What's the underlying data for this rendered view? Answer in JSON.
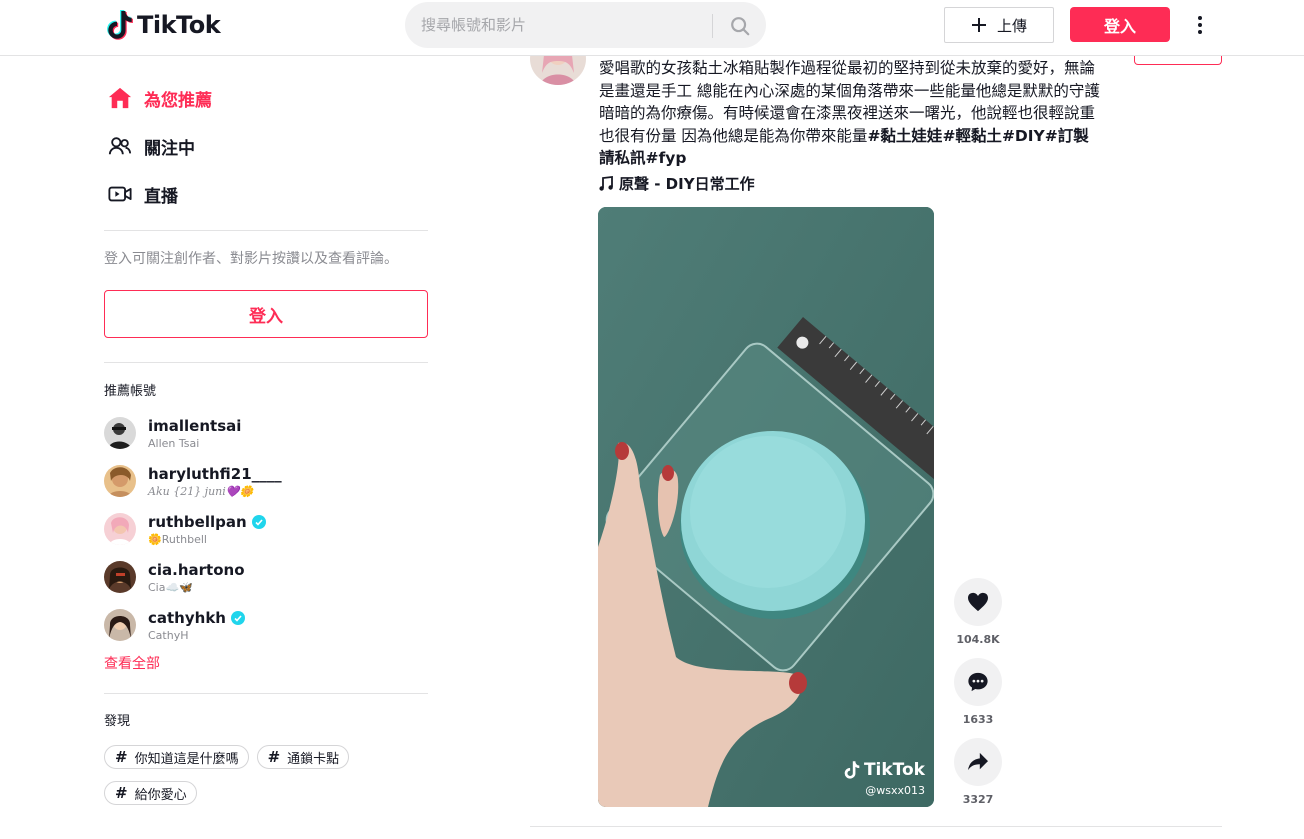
{
  "header": {
    "logo_text": "TikTok",
    "search_placeholder": "搜尋帳號和影片",
    "upload_label": "上傳",
    "login_label": "登入"
  },
  "sidebar": {
    "nav": [
      {
        "label": "為您推薦",
        "icon": "home-icon",
        "active": true
      },
      {
        "label": "關注中",
        "icon": "users-icon",
        "active": false
      },
      {
        "label": "直播",
        "icon": "live-icon",
        "active": false
      }
    ],
    "login_prompt": "登入可關注創作者、對影片按讚以及查看評論。",
    "login_button": "登入",
    "suggested_title": "推薦帳號",
    "accounts": [
      {
        "username": "imallentsai",
        "nickname": "Allen Tsai",
        "verified": false
      },
      {
        "username": "haryluthfi21____",
        "nickname": "Aku {21} juni💜🌼",
        "verified": false
      },
      {
        "username": "ruthbellpan",
        "nickname": "🌼Ruthbell",
        "verified": true
      },
      {
        "username": "cia.hartono",
        "nickname": "Cia☁️🦋",
        "verified": false
      },
      {
        "username": "cathyhkh",
        "nickname": "CathyH",
        "verified": true
      }
    ],
    "see_all": "查看全部",
    "discover_title": "發現",
    "tags": [
      "你知道這是什麼嗎",
      "通鎖卡點",
      "給你愛心"
    ]
  },
  "post": {
    "description_text": "愛唱歌的女孩黏土冰箱貼製作過程從最初的堅持到從未放棄的愛好，無論是畫還是手工 總能在內心深處的某個角落帶來一些能量他總是默默的守護暗暗的為你療傷。有時候還會在漆黑夜裡送來一曙光，他說輕也很輕說重也很有份量 因為他總是能為你帶來能量",
    "hashtags": [
      "#黏土娃娃",
      "#輕黏土",
      "#DIY",
      "#訂製請私訊",
      "#fyp"
    ],
    "music": "原聲 - DIY日常工作",
    "watermark_logo": "TikTok",
    "watermark_user": "@wsxx013",
    "likes": "104.8K",
    "comments": "1633",
    "shares": "3327"
  },
  "colors": {
    "brand": "#fe2c55",
    "verified": "#20d5ec",
    "text": "#161823",
    "muted": "#8a8b91"
  }
}
